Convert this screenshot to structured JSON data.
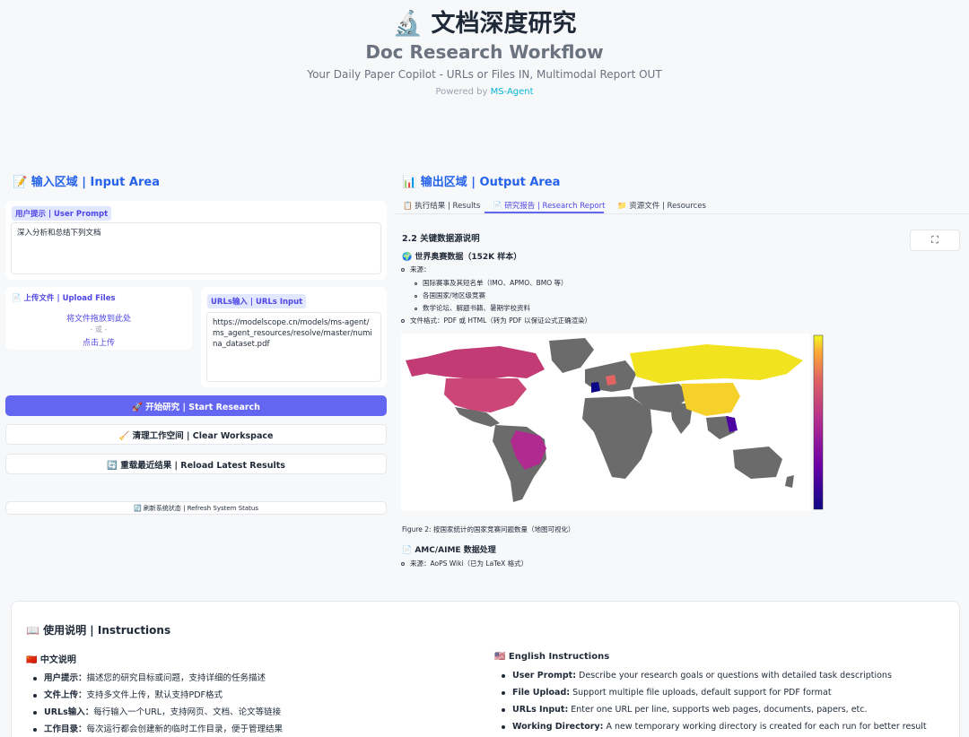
{
  "header": {
    "title": "🔬 文档深度研究",
    "subtitle": "Doc Research Workflow",
    "tagline": "Your Daily Paper Copilot - URLs or Files IN, Multimodal Report OUT",
    "powered_prefix": "Powered by ",
    "powered_link": "MS-Agent"
  },
  "input_area": {
    "title": "📝 输入区域 | Input Area",
    "user_prompt_label": "用户提示 | User Prompt",
    "user_prompt_value": "深入分析和总结下列文档",
    "upload_label": "📄 上传文件 | Upload Files",
    "upload_drop": "将文件拖放到此处",
    "upload_or": "- 或 -",
    "upload_click": "点击上传",
    "urls_label": "URLs输入 | URLs Input",
    "urls_value": "https://modelscope.cn/models/ms-agent/ms_agent_resources/resolve/master/numina_dataset.pdf",
    "start_button": "🚀 开始研究 | Start Research",
    "clear_button": "🧹 清理工作空间 | Clear Workspace",
    "reload_button": "🔄 重载最近结果 | Reload Latest Results",
    "refresh_button": "🔄 刷新系统状态 | Refresh System Status"
  },
  "output_area": {
    "title": "📊 输出区域 | Output Area",
    "tabs": [
      {
        "label": "📋 执行结果 | Results"
      },
      {
        "label": "📄 研究报告 | Research Report"
      },
      {
        "label": "📁 资源文件 | Resources"
      }
    ],
    "fullscreen_icon": "⛶",
    "report": {
      "section": "2.2 关键数据源说明",
      "world_heading": "🌍 世界奥赛数据（152K 样本）",
      "source_label": "来源：",
      "sources": [
        "国际赛事及其短名单（IMO、APMO、BMO 等）",
        "各国国家/地区级竞赛",
        "数学论坛、解题书籍、暑期学校资料"
      ],
      "format": "文件格式：PDF 或 HTML（转为 PDF 以保证公式正确渲染）",
      "figure_caption": "Figure 2: 按国家统计的国家竞赛问题数量（地图可视化）",
      "amc_heading": "📄 AMC/AIME 数据处理",
      "amc_source": "来源：AoPS Wiki（已为 LaTeX 格式）"
    }
  },
  "instructions": {
    "title": "📖 使用说明 | Instructions",
    "zh_title": "🇨🇳 中文说明",
    "zh_items": [
      {
        "k": "用户提示：",
        "v": "描述您的研究目标或问题，支持详细的任务描述"
      },
      {
        "k": "文件上传：",
        "v": "支持多文件上传，默认支持PDF格式"
      },
      {
        "k": "URLs输入：",
        "v": "每行输入一个URL，支持网页、文档、论文等链接"
      },
      {
        "k": "工作目录：",
        "v": "每次运行都会创建新的临时工作目录，便于管理结果"
      }
    ],
    "en_title": "🇺🇸 English Instructions",
    "en_items": [
      {
        "k": "User Prompt:",
        "v": " Describe your research goals or questions with detailed task descriptions"
      },
      {
        "k": "File Upload:",
        "v": " Support multiple file uploads, default support for PDF format"
      },
      {
        "k": "URLs Input:",
        "v": " Enter one URL per line, supports web pages, documents, papers, etc."
      },
      {
        "k": "Working Directory:",
        "v": " A new temporary working directory is created for each run for better result"
      }
    ]
  },
  "colors": {
    "accent": "#6366f1",
    "title_blue": "#2563eb",
    "link_cyan": "#06b6d4"
  }
}
